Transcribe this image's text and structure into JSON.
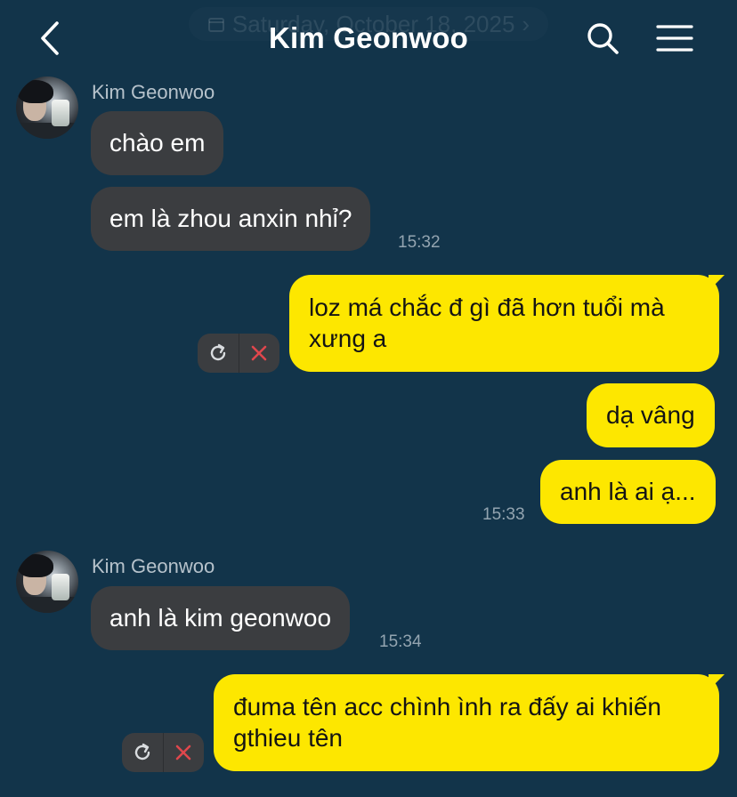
{
  "header": {
    "title": "Kim Geonwoo",
    "date_label": "Saturday, October 18, 2025",
    "date_chevron": "›",
    "back_icon": "chevron-left-icon",
    "search_icon": "search-icon",
    "menu_icon": "hamburger-menu-icon"
  },
  "colors": {
    "background": "#12344a",
    "incoming_bubble": "#3b3d40",
    "outgoing_bubble": "#fde700",
    "failed_x": "#e0474c"
  },
  "messages": {
    "g1": {
      "sender": "Kim Geonwoo",
      "m1": "chào em",
      "m2": "em là zhou anxin nhỉ?",
      "time": "15:32"
    },
    "o1": {
      "line1": "loz má chắc đ gì đã hơn tuổi mà",
      "line2": "xưng a"
    },
    "o2": {
      "text": "dạ vâng"
    },
    "o3": {
      "text": "anh là ai ạ...",
      "time": "15:33"
    },
    "g2": {
      "sender": "Kim Geonwoo",
      "m1": "anh là kim geonwoo",
      "time": "15:34"
    },
    "o4": {
      "line1": "đuma tên acc chình ình ra đấy ai khiến",
      "line2": "gthieu tên"
    }
  },
  "actions": {
    "retry_icon": "retry-icon",
    "delete_icon": "close-icon"
  }
}
